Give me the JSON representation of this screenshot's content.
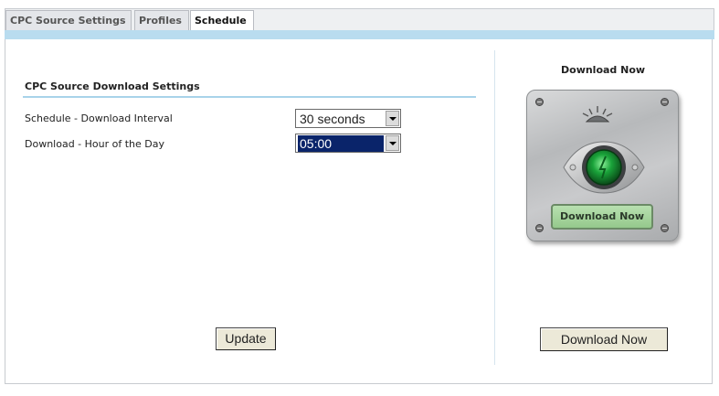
{
  "tabs": [
    {
      "label": "CPC Source Settings",
      "active": false
    },
    {
      "label": "Profiles",
      "active": false
    },
    {
      "label": "Schedule",
      "active": true
    }
  ],
  "settings": {
    "section_title": "CPC Source Download Settings",
    "interval_label": "Schedule - Download Interval",
    "interval_value": "30 seconds",
    "hour_label": "Download - Hour of the Day",
    "hour_value": "05:00"
  },
  "actions": {
    "update_label": "Update"
  },
  "download": {
    "title": "Download Now",
    "device_label": "Download Now",
    "button_label": "Download Now"
  },
  "colors": {
    "accent_strip": "#b9dcef",
    "device_green": "#1aa33a",
    "select_highlight": "#0a246a"
  }
}
